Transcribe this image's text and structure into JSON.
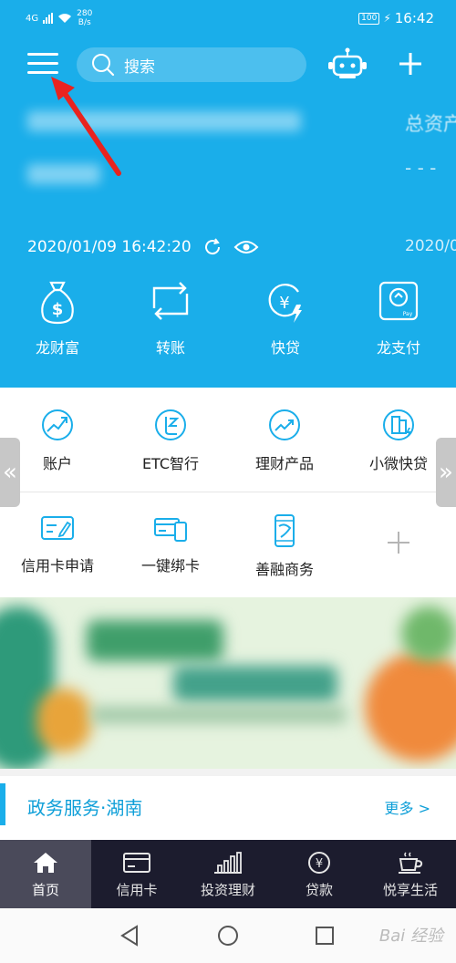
{
  "status_bar": {
    "network": "4G",
    "speed_value": "280",
    "speed_unit": "B/s",
    "battery": "100",
    "time": "16:42"
  },
  "header": {
    "search_placeholder": "搜索"
  },
  "account": {
    "total_assets_label": "总资产",
    "total_assets_value": "- - -",
    "datetime": "2020/01/09 16:42:20",
    "datetime_right": "2020/0"
  },
  "quick_actions": [
    {
      "label": "龙财富",
      "icon": "money-bag-icon"
    },
    {
      "label": "转账",
      "icon": "transfer-icon"
    },
    {
      "label": "快贷",
      "icon": "quick-loan-icon"
    },
    {
      "label": "龙支付",
      "icon": "long-pay-icon"
    }
  ],
  "services": [
    {
      "label": "账户",
      "icon": "account-chart-icon"
    },
    {
      "label": "ETC智行",
      "icon": "etc-icon"
    },
    {
      "label": "理财产品",
      "icon": "wealth-products-icon"
    },
    {
      "label": "小微快贷",
      "icon": "small-loan-icon"
    },
    {
      "label": "信用卡申请",
      "icon": "credit-card-apply-icon"
    },
    {
      "label": "一键绑卡",
      "icon": "bind-card-icon"
    },
    {
      "label": "善融商务",
      "icon": "shanrong-icon"
    },
    {
      "label": "",
      "icon": "plus-icon"
    }
  ],
  "nav_arrows": {
    "left": "«",
    "right": "»"
  },
  "gov_services": {
    "title": "政务服务·湖南",
    "more": "更多 >"
  },
  "tabs": [
    {
      "label": "首页",
      "icon": "home-icon",
      "active": true
    },
    {
      "label": "信用卡",
      "icon": "credit-card-icon",
      "active": false
    },
    {
      "label": "投资理财",
      "icon": "bar-chart-icon",
      "active": false
    },
    {
      "label": "贷款",
      "icon": "yuan-coin-icon",
      "active": false
    },
    {
      "label": "悦享生活",
      "icon": "coffee-cup-icon",
      "active": false
    }
  ],
  "watermark": "Bai 经验",
  "colors": {
    "primary_blue": "#1aaeea",
    "tab_bar": "#1c1c2e",
    "annotation_red": "#e8231f"
  }
}
